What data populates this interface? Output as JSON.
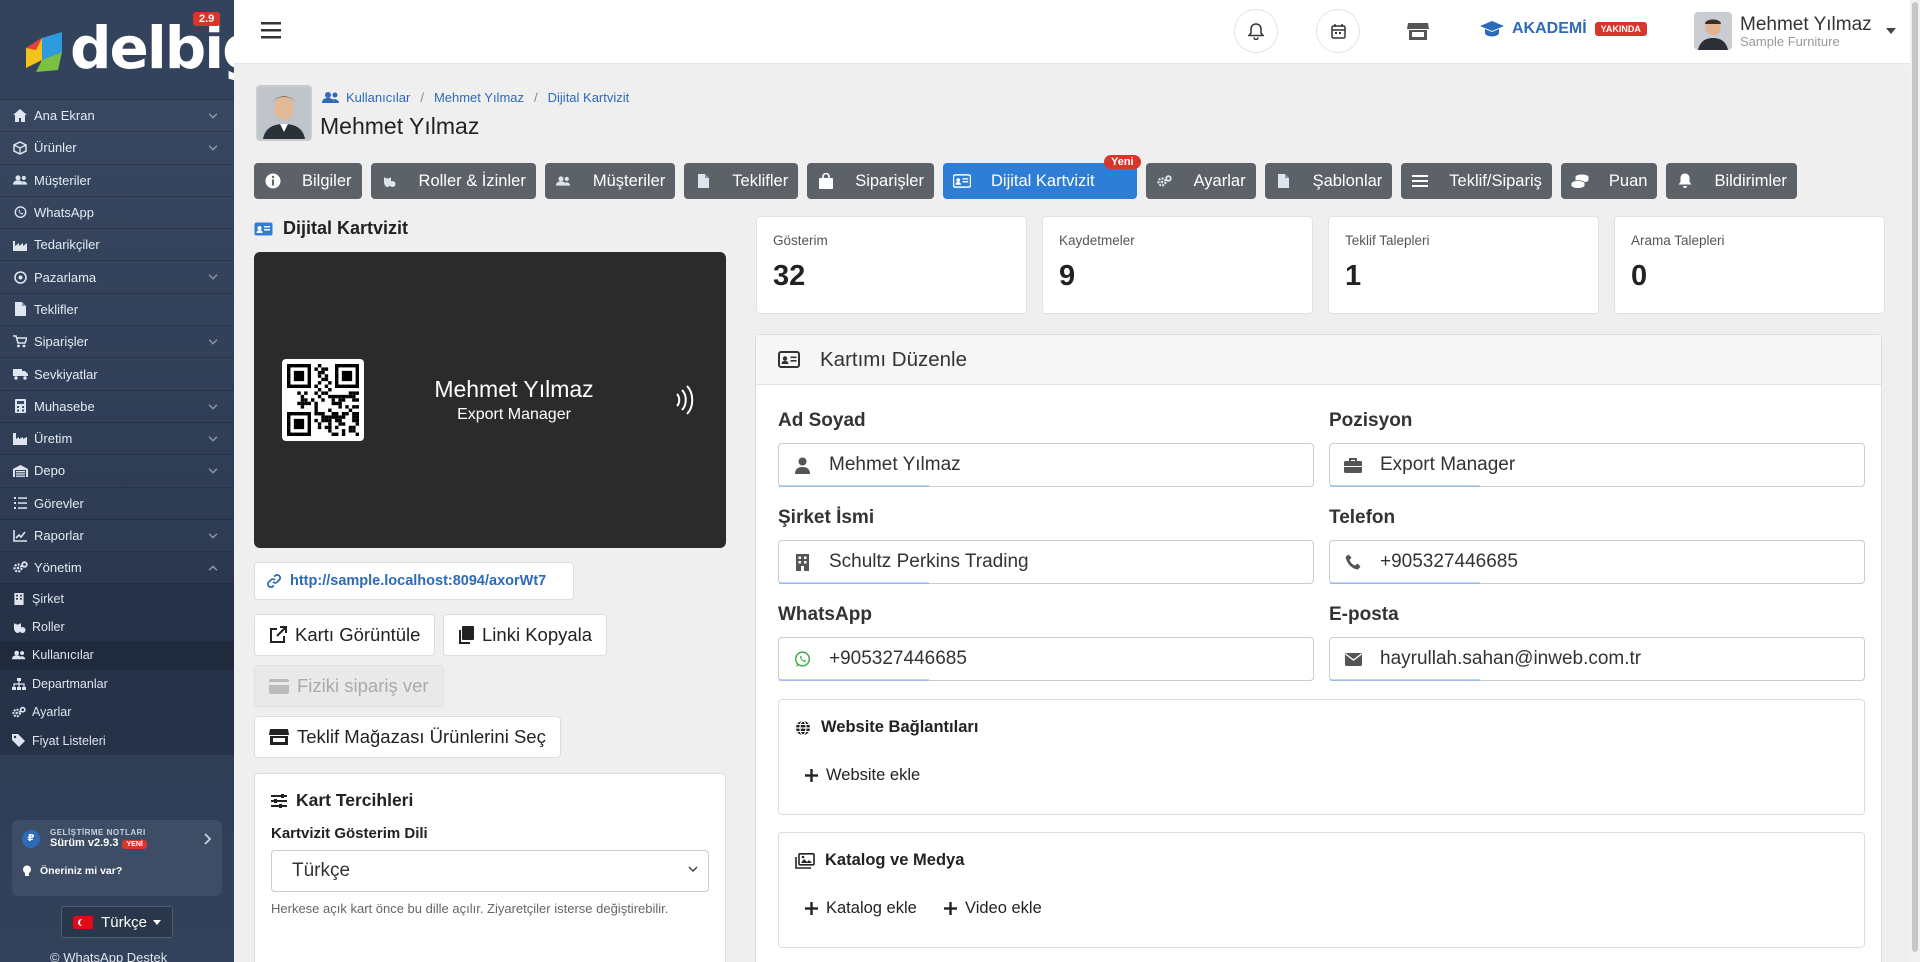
{
  "app": {
    "logo_text": "delbig",
    "version_badge": "2.9"
  },
  "sidebar": {
    "items": [
      {
        "label": "Ana Ekran",
        "icon": "home-icon",
        "has_sub": true
      },
      {
        "label": "Ürünler",
        "icon": "cube-icon",
        "has_sub": true
      },
      {
        "label": "Müşteriler",
        "icon": "users-icon",
        "has_sub": false
      },
      {
        "label": "WhatsApp",
        "icon": "whatsapp-icon",
        "has_sub": false
      },
      {
        "label": "Tedarikçiler",
        "icon": "factory-icon",
        "has_sub": false
      },
      {
        "label": "Pazarlama",
        "icon": "target-icon",
        "has_sub": true
      },
      {
        "label": "Teklifler",
        "icon": "file-icon",
        "has_sub": false
      },
      {
        "label": "Siparişler",
        "icon": "cart-icon",
        "has_sub": true
      },
      {
        "label": "Sevkiyatlar",
        "icon": "truck-icon",
        "has_sub": false
      },
      {
        "label": "Muhasebe",
        "icon": "calculator-icon",
        "has_sub": true
      },
      {
        "label": "Üretim",
        "icon": "industry-icon",
        "has_sub": true
      },
      {
        "label": "Depo",
        "icon": "warehouse-icon",
        "has_sub": true
      },
      {
        "label": "Görevler",
        "icon": "tasks-icon",
        "has_sub": false
      },
      {
        "label": "Raporlar",
        "icon": "chart-icon",
        "has_sub": true
      },
      {
        "label": "Yönetim",
        "icon": "cogs-icon",
        "has_sub": true
      }
    ],
    "sub_items": [
      {
        "label": "Şirket",
        "icon": "building-icon"
      },
      {
        "label": "Roller",
        "icon": "roles-icon"
      },
      {
        "label": "Kullanıcılar",
        "icon": "users-icon"
      },
      {
        "label": "Departmanlar",
        "icon": "sitemap-icon"
      },
      {
        "label": "Ayarlar",
        "icon": "cogs-icon"
      },
      {
        "label": "Fiyat Listeleri",
        "icon": "tags-icon"
      }
    ],
    "dev_notes_label": "GELİŞTİRME NOTLARI",
    "dev_version": "Sürüm v2.9.3",
    "dev_new": "YENİ",
    "suggestion": "Öneriniz mi var?",
    "language": "Türkçe",
    "whatsapp_support": "WhatsApp Destek"
  },
  "header": {
    "akademi_label": "AKADEMİ",
    "akademi_badge": "YAKINDA",
    "user_name": "Mehmet Yılmaz",
    "user_company": "Sample Furniture"
  },
  "page": {
    "breadcrumb": [
      "Kullanıcılar",
      "Mehmet Yılmaz",
      "Dijital Kartvizit"
    ],
    "title": "Mehmet Yılmaz"
  },
  "tabs": [
    {
      "label": "Bilgiler",
      "icon": "info-icon"
    },
    {
      "label": "Roller & İzinler",
      "icon": "roles-icon"
    },
    {
      "label": "Müşteriler",
      "icon": "users-icon"
    },
    {
      "label": "Teklifler",
      "icon": "file-icon"
    },
    {
      "label": "Siparişler",
      "icon": "bag-icon"
    },
    {
      "label": "Dijital Kartvizit",
      "icon": "id-card-icon",
      "active": true,
      "badge": "Yeni"
    },
    {
      "label": "Ayarlar",
      "icon": "cogs-icon"
    },
    {
      "label": "Şablonlar",
      "icon": "file-icon"
    },
    {
      "label": "Teklif/Sipariş",
      "icon": "sliders-icon"
    },
    {
      "label": "Puan",
      "icon": "coins-icon"
    },
    {
      "label": "Bildirimler",
      "icon": "bell-icon"
    }
  ],
  "left": {
    "section_title": "Dijital Kartvizit",
    "card_name": "Mehmet Yılmaz",
    "card_position": "Export Manager",
    "card_link": "http://sample.localhost:8094/axorWt7",
    "btn_view": "Kartı Görüntüle",
    "btn_copy": "Linki Kopyala",
    "btn_order": "Fiziki sipariş ver",
    "btn_store": "Teklif Mağazası Ürünlerini Seç",
    "prefs_title": "Kart Tercihleri",
    "lang_label": "Kartvizit Gösterim Dili",
    "lang_value": "Türkçe",
    "lang_help": "Herkese açık kart önce bu dille açılır. Ziyaretçiler isterse değiştirebilir."
  },
  "stats": [
    {
      "label": "Gösterim",
      "value": "32"
    },
    {
      "label": "Kaydetmeler",
      "value": "9"
    },
    {
      "label": "Teklif Talepleri",
      "value": "1"
    },
    {
      "label": "Arama Talepleri",
      "value": "0"
    }
  ],
  "edit": {
    "title": "Kartımı Düzenle",
    "fields": {
      "name_label": "Ad Soyad",
      "name_value": "Mehmet Yılmaz",
      "position_label": "Pozisyon",
      "position_value": "Export Manager",
      "company_label": "Şirket İsmi",
      "company_value": "Schultz Perkins Trading",
      "phone_label": "Telefon",
      "phone_value": "+905327446685",
      "whatsapp_label": "WhatsApp",
      "whatsapp_value": "+905327446685",
      "email_label": "E-posta",
      "email_value": "hayrullah.sahan@inweb.com.tr"
    },
    "website_title": "Website Bağlantıları",
    "website_add": "Website ekle",
    "catalog_title": "Katalog ve Medya",
    "catalog_add": "Katalog ekle",
    "video_add": "Video ekle"
  },
  "colors": {
    "accent": "#2e7dd6",
    "tab_bg": "#5d6168",
    "sidebar_bg": "#33425b",
    "badge_red": "#d9362b",
    "link": "#2d6bb8"
  }
}
